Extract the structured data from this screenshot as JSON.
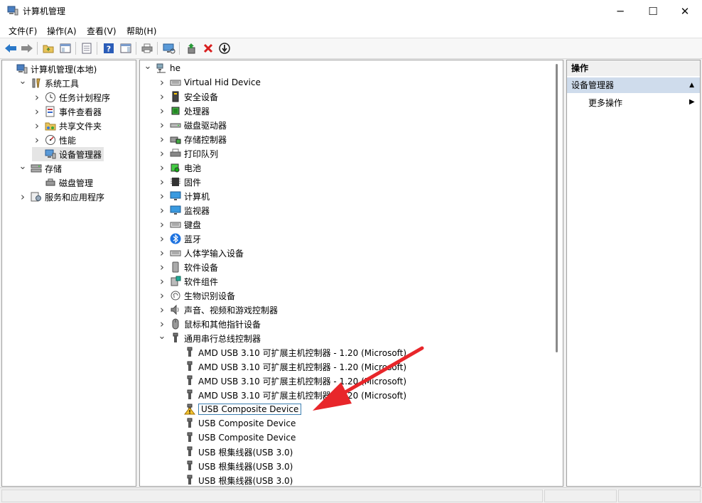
{
  "window": {
    "title": "计算机管理",
    "minimize": "─",
    "maximize": "☐",
    "close": "✕"
  },
  "menu": [
    "文件(F)",
    "操作(A)",
    "查看(V)",
    "帮助(H)"
  ],
  "toolbar": {
    "icons": [
      "back-arrow-icon",
      "forward-arrow-icon",
      "up-folder-icon",
      "show-hide-tree-icon",
      "properties-icon",
      "help-icon",
      "show-action-pane-icon",
      "print-icon",
      "scan-hardware-icon",
      "update-driver-icon",
      "uninstall-device-icon",
      "disable-device-icon"
    ]
  },
  "left_tree": [
    {
      "label": "计算机管理(本地)",
      "level": 0,
      "expander": "",
      "icon": "computer-management-icon"
    },
    {
      "label": "系统工具",
      "level": 1,
      "expander": "down",
      "icon": "tools-icon"
    },
    {
      "label": "任务计划程序",
      "level": 2,
      "expander": "right",
      "icon": "clock-icon"
    },
    {
      "label": "事件查看器",
      "level": 2,
      "expander": "right",
      "icon": "event-viewer-icon"
    },
    {
      "label": "共享文件夹",
      "level": 2,
      "expander": "right",
      "icon": "shared-folder-icon"
    },
    {
      "label": "性能",
      "level": 2,
      "expander": "right",
      "icon": "performance-icon"
    },
    {
      "label": "设备管理器",
      "level": 2,
      "expander": "",
      "icon": "device-manager-icon",
      "selected": true
    },
    {
      "label": "存储",
      "level": 1,
      "expander": "down",
      "icon": "storage-icon"
    },
    {
      "label": "磁盘管理",
      "level": 2,
      "expander": "",
      "icon": "disk-management-icon"
    },
    {
      "label": "服务和应用程序",
      "level": 1,
      "expander": "right",
      "icon": "services-icon"
    }
  ],
  "device_tree": [
    {
      "label": "he",
      "level": 0,
      "expander": "down",
      "icon": "computer-network-icon"
    },
    {
      "label": "Virtual Hid Device",
      "level": 1,
      "expander": "right",
      "icon": "keyboard-icon"
    },
    {
      "label": "安全设备",
      "level": 1,
      "expander": "right",
      "icon": "security-device-icon"
    },
    {
      "label": "处理器",
      "level": 1,
      "expander": "right",
      "icon": "processor-icon"
    },
    {
      "label": "磁盘驱动器",
      "level": 1,
      "expander": "right",
      "icon": "disk-drive-icon"
    },
    {
      "label": "存储控制器",
      "level": 1,
      "expander": "right",
      "icon": "storage-controller-icon"
    },
    {
      "label": "打印队列",
      "level": 1,
      "expander": "right",
      "icon": "printer-icon"
    },
    {
      "label": "电池",
      "level": 1,
      "expander": "right",
      "icon": "battery-icon"
    },
    {
      "label": "固件",
      "level": 1,
      "expander": "right",
      "icon": "firmware-icon"
    },
    {
      "label": "计算机",
      "level": 1,
      "expander": "right",
      "icon": "monitor-icon"
    },
    {
      "label": "监视器",
      "level": 1,
      "expander": "right",
      "icon": "monitor-icon"
    },
    {
      "label": "键盘",
      "level": 1,
      "expander": "right",
      "icon": "keyboard-icon"
    },
    {
      "label": "蓝牙",
      "level": 1,
      "expander": "right",
      "icon": "bluetooth-icon"
    },
    {
      "label": "人体学输入设备",
      "level": 1,
      "expander": "right",
      "icon": "keyboard-icon"
    },
    {
      "label": "软件设备",
      "level": 1,
      "expander": "right",
      "icon": "software-device-icon"
    },
    {
      "label": "软件组件",
      "level": 1,
      "expander": "right",
      "icon": "software-component-icon"
    },
    {
      "label": "生物识别设备",
      "level": 1,
      "expander": "right",
      "icon": "fingerprint-icon"
    },
    {
      "label": "声音、视频和游戏控制器",
      "level": 1,
      "expander": "right",
      "icon": "speaker-icon"
    },
    {
      "label": "鼠标和其他指针设备",
      "level": 1,
      "expander": "right",
      "icon": "mouse-icon"
    },
    {
      "label": "通用串行总线控制器",
      "level": 1,
      "expander": "down",
      "icon": "usb-icon"
    },
    {
      "label": "AMD USB 3.10 可扩展主机控制器 - 1.20 (Microsoft)",
      "level": 2,
      "expander": "",
      "icon": "usb-icon"
    },
    {
      "label": "AMD USB 3.10 可扩展主机控制器 - 1.20 (Microsoft)",
      "level": 2,
      "expander": "",
      "icon": "usb-icon"
    },
    {
      "label": "AMD USB 3.10 可扩展主机控制器 - 1.20 (Microsoft)",
      "level": 2,
      "expander": "",
      "icon": "usb-icon"
    },
    {
      "label": "AMD USB 3.10 可扩展主机控制器 - 1.20 (Microsoft)",
      "level": 2,
      "expander": "",
      "icon": "usb-icon"
    },
    {
      "label": "USB Composite Device",
      "level": 2,
      "expander": "",
      "icon": "warning-icon",
      "focused": true
    },
    {
      "label": "USB Composite Device",
      "level": 2,
      "expander": "",
      "icon": "usb-icon"
    },
    {
      "label": "USB Composite Device",
      "level": 2,
      "expander": "",
      "icon": "usb-icon"
    },
    {
      "label": "USB 根集线器(USB 3.0)",
      "level": 2,
      "expander": "",
      "icon": "usb-icon"
    },
    {
      "label": "USB 根集线器(USB 3.0)",
      "level": 2,
      "expander": "",
      "icon": "usb-icon"
    },
    {
      "label": "USB 根集线器(USB 3.0)",
      "level": 2,
      "expander": "",
      "icon": "usb-icon"
    }
  ],
  "actions": {
    "title": "操作",
    "group": "设备管理器",
    "more": "更多操作"
  },
  "colors": {
    "annotation_arrow": "#e8262a",
    "focus_border": "#3c7fb1",
    "action_group_bg": "#cfdcec"
  }
}
